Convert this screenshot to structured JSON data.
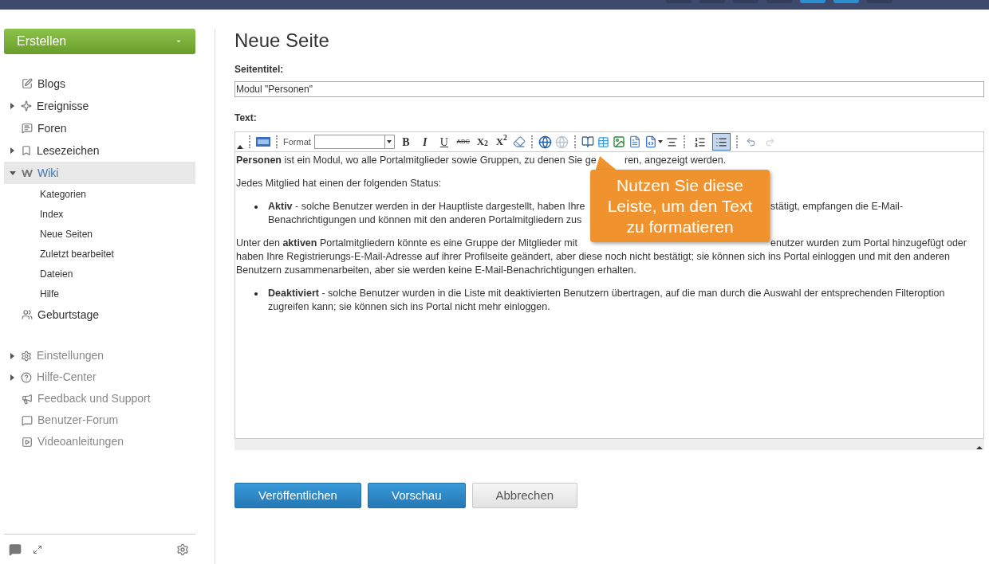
{
  "top_bar": {
    "buttons": [
      {
        "selected": false
      },
      {
        "selected": false
      },
      {
        "selected": false
      },
      {
        "selected": false
      },
      {
        "selected": true
      },
      {
        "selected": true
      },
      {
        "selected": false
      }
    ]
  },
  "sidebar": {
    "create_button": "Erstellen",
    "nav": [
      {
        "label": "Blogs",
        "selected": false
      },
      {
        "label": "Ereignisse",
        "expanded": false,
        "selected": false
      },
      {
        "label": "Foren",
        "selected": false
      },
      {
        "label": "Lesezeichen",
        "expanded": false,
        "selected": false
      },
      {
        "label": "Wiki",
        "expanded": true,
        "selected": true,
        "children": [
          {
            "label": "Kategorien"
          },
          {
            "label": "Index"
          },
          {
            "label": "Neue Seiten"
          },
          {
            "label": "Zuletzt bearbeitet"
          },
          {
            "label": "Dateien"
          },
          {
            "label": "Hilfe"
          }
        ]
      },
      {
        "label": "Geburtstage",
        "selected": false
      }
    ],
    "help_nav": [
      {
        "label": "Einstellungen",
        "expanded": false
      },
      {
        "label": "Hilfe-Center",
        "expanded": false
      },
      {
        "label": "Feedback und Support"
      },
      {
        "label": "Benutzer-Forum"
      },
      {
        "label": "Videoanleitungen"
      }
    ]
  },
  "page": {
    "title": "Neue Seite",
    "title_label": "Seitentitel:",
    "title_value": "Modul \"Personen\"",
    "text_label": "Text:",
    "toolbar": {
      "format_label": "Format",
      "text_buttons": [
        {
          "text": "B",
          "kind": "bold"
        },
        {
          "text": "I",
          "kind": "italic"
        },
        {
          "text": "U",
          "kind": "underline"
        },
        {
          "text": "ABC",
          "kind": "strike"
        },
        {
          "text": "X$_{2}$",
          "kind": "plain"
        },
        {
          "text": "X$^{2}$",
          "kind": "plain"
        }
      ],
      "list_buttons": [
        {
          "selected": false
        },
        {
          "selected": true
        }
      ],
      "history_buttons": [
        {
          "disabled": false
        },
        {
          "disabled": true
        }
      ]
    },
    "editor_lines": [
      {
        "kind": "text",
        "segments": [
          "**Personen** ist ein Modul, wo alle Portalmitglieder sowie Gruppen, zu denen Sie ge",
          "ren, angezeigt werden."
        ]
      },
      {
        "kind": "text",
        "segments": [
          "Jedes Mitglied hat einen der folgenden Status:"
        ]
      },
      {
        "kind": "bullet",
        "segments": [
          "**Aktiv** - solche Benutzer werden in der Hauptliste dargestellt, haben Ihre",
          "stätigt, empfangen die E-Mail-"
        ]
      },
      {
        "kind": "continuation",
        "segments": [
          "Benachrichtigungen und können mit den anderen Portalmitgliedern zus"
        ]
      },
      {
        "kind": "text",
        "segments": [
          "Unter den **aktiven** Portalmitgliedern könnte es eine Gruppe der Mitglieder mit",
          "enutzer wurden zum Portal hinzugefügt oder"
        ]
      },
      {
        "kind": "text-next",
        "segments": [
          "haben Ihre Registrierungs-E-Mail-Adresse auf ihrer Profilseite geändert, aber diese noch nicht bestätigt; sie können sich ins Portal einloggen und mit den anderen"
        ]
      },
      {
        "kind": "text-next",
        "segments": [
          "Benutzern zusammenarbeiten, aber sie werden keine E-Mail-Benachrichtigungen erhalten."
        ]
      },
      {
        "kind": "bullet",
        "segments": [
          "**Deaktiviert** - solche Benutzer wurden in die Liste mit deaktivierten Benutzern übertragen, auf die man durch die Auswahl der entsprechenden Filteroption"
        ]
      },
      {
        "kind": "continuation",
        "segments": [
          "zugreifen kann; sie können sich ins Portal nicht mehr einloggen."
        ]
      }
    ],
    "callout": "Nutzen Sie diese Leiste, um den Text zu formatieren",
    "buttons": [
      {
        "label": "Veröffentlichen",
        "kind": "primary"
      },
      {
        "label": "Vorschau",
        "kind": "primary"
      },
      {
        "label": "Abbrechen",
        "kind": "secondary"
      }
    ]
  }
}
